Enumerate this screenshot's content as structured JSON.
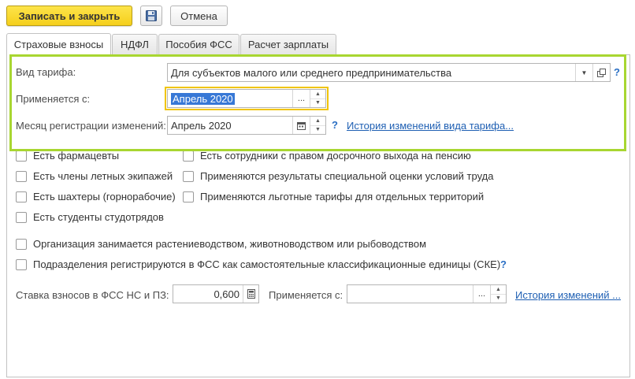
{
  "toolbar": {
    "save_close_label": "Записать и закрыть",
    "save_icon": "floppy-disk-icon",
    "cancel_label": "Отмена"
  },
  "tabs": [
    {
      "label": "Страховые взносы",
      "active": true
    },
    {
      "label": "НДФЛ",
      "active": false
    },
    {
      "label": "Пособия ФСС",
      "active": false
    },
    {
      "label": "Расчет зарплаты",
      "active": false
    }
  ],
  "tariff": {
    "type_label": "Вид тарифа:",
    "type_value": "Для субъектов малого или среднего предпринимательства",
    "type_help": "?",
    "applies_label": "Применяется с:",
    "applies_value": "Апрель 2020",
    "applies_btn": "...",
    "reg_label": "Месяц регистрации изменений:",
    "reg_value": "Апрель 2020",
    "reg_help": "?",
    "history_link": "История изменений вида тарифа..."
  },
  "checkboxes_left": [
    "Есть фармацевты",
    "Есть члены летных экипажей",
    "Есть шахтеры (горнорабочие)",
    "Есть студенты студотрядов"
  ],
  "checkboxes_right": [
    "Есть сотрудники с правом досрочного выхода на пенсию",
    "Применяются результаты специальной оценки условий труда",
    "Применяются льготные тарифы для отдельных территорий"
  ],
  "checkboxes_wide": [
    "Организация занимается растениеводством, животноводством или рыбоводством",
    "Подразделения регистрируются в ФСС как самостоятельные классификационные единицы (СКЕ)"
  ],
  "cke_help": "?",
  "fss": {
    "rate_label": "Ставка взносов в ФСС НС и ПЗ:",
    "rate_value": "0,600",
    "applies_label": "Применяется с:",
    "applies_value": "",
    "applies_btn": "...",
    "history_link": "История изменений ..."
  },
  "colors": {
    "primary_button": "#f5cf1c",
    "highlight_border": "#a8d631",
    "focus_outline": "#f0c400",
    "link": "#1e5fb3",
    "selection": "#3778d6"
  }
}
